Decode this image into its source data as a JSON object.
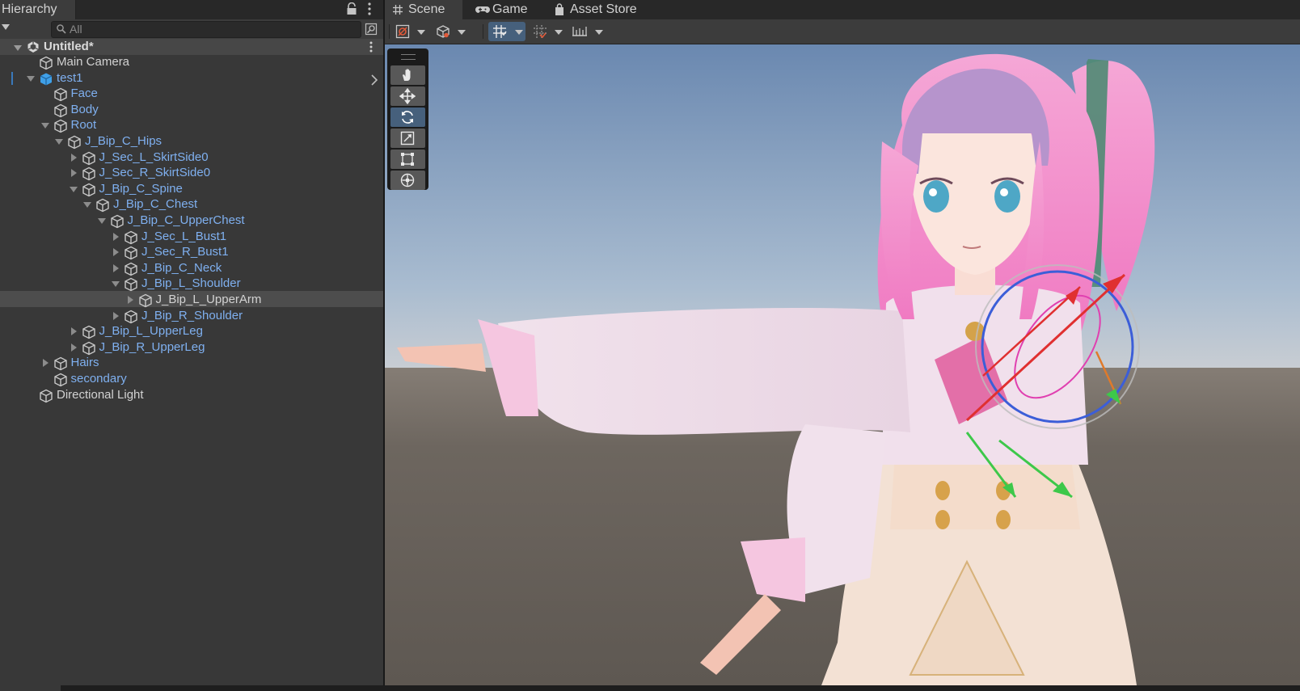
{
  "hierarchy": {
    "title": "Hierarchy",
    "search_placeholder": "All",
    "scene_name": "Untitled*",
    "items": [
      {
        "label": "Main Camera",
        "fold": "none",
        "style": "norm",
        "icon": "gameobject-icon"
      },
      {
        "label": "test1",
        "fold": "open",
        "style": "prefab",
        "icon": "prefab-icon"
      },
      {
        "label": "Face",
        "fold": "none",
        "style": "prefab",
        "icon": "gameobject-icon"
      },
      {
        "label": "Body",
        "fold": "none",
        "style": "prefab",
        "icon": "gameobject-icon"
      },
      {
        "label": "Root",
        "fold": "open",
        "style": "prefab",
        "icon": "gameobject-icon"
      },
      {
        "label": "J_Bip_C_Hips",
        "fold": "open",
        "style": "prefab",
        "icon": "gameobject-icon"
      },
      {
        "label": "J_Sec_L_SkirtSide0",
        "fold": "closed",
        "style": "prefab",
        "icon": "gameobject-icon"
      },
      {
        "label": "J_Sec_R_SkirtSide0",
        "fold": "closed",
        "style": "prefab",
        "icon": "gameobject-icon"
      },
      {
        "label": "J_Bip_C_Spine",
        "fold": "open",
        "style": "prefab",
        "icon": "gameobject-icon"
      },
      {
        "label": "J_Bip_C_Chest",
        "fold": "open",
        "style": "prefab",
        "icon": "gameobject-icon"
      },
      {
        "label": "J_Bip_C_UpperChest",
        "fold": "open",
        "style": "prefab",
        "icon": "gameobject-icon"
      },
      {
        "label": "J_Sec_L_Bust1",
        "fold": "closed",
        "style": "prefab",
        "icon": "gameobject-icon"
      },
      {
        "label": "J_Sec_R_Bust1",
        "fold": "closed",
        "style": "prefab",
        "icon": "gameobject-icon"
      },
      {
        "label": "J_Bip_C_Neck",
        "fold": "closed",
        "style": "prefab",
        "icon": "gameobject-icon"
      },
      {
        "label": "J_Bip_L_Shoulder",
        "fold": "open",
        "style": "prefab",
        "icon": "gameobject-icon"
      },
      {
        "label": "J_Bip_L_UpperArm",
        "fold": "closed",
        "style": "norm",
        "icon": "gameobject-icon",
        "selected": true
      },
      {
        "label": "J_Bip_R_Shoulder",
        "fold": "closed",
        "style": "prefab",
        "icon": "gameobject-icon"
      },
      {
        "label": "J_Bip_L_UpperLeg",
        "fold": "closed",
        "style": "prefab",
        "icon": "gameobject-icon"
      },
      {
        "label": "J_Bip_R_UpperLeg",
        "fold": "closed",
        "style": "prefab",
        "icon": "gameobject-icon"
      },
      {
        "label": "Hairs",
        "fold": "closed",
        "style": "prefab",
        "icon": "gameobject-icon"
      },
      {
        "label": "secondary",
        "fold": "none",
        "style": "prefab",
        "icon": "gameobject-icon"
      },
      {
        "label": "Directional Light",
        "fold": "none",
        "style": "norm",
        "icon": "gameobject-icon"
      }
    ]
  },
  "scene_view": {
    "tabs": [
      {
        "label": "Scene",
        "icon": "grid-icon",
        "active": true
      },
      {
        "label": "Game",
        "icon": "gamepad-icon",
        "active": false
      },
      {
        "label": "Asset Store",
        "icon": "shopping-bag-icon",
        "active": false
      }
    ],
    "toolbar": [
      "draw-mode-icon",
      "shading-cube-icon",
      "grid-snap-icon",
      "increment-snap-icon",
      "ruler-icon"
    ],
    "tools": [
      {
        "name": "hand-tool-icon",
        "active": false
      },
      {
        "name": "move-tool-icon",
        "active": false
      },
      {
        "name": "rotate-tool-icon",
        "active": true
      },
      {
        "name": "scale-tool-icon",
        "active": false
      },
      {
        "name": "rect-tool-icon",
        "active": false
      },
      {
        "name": "transform-tool-icon",
        "active": false
      }
    ]
  },
  "colors": {
    "panel": "#383838",
    "selection": "#4d4d4d",
    "prefab_text": "#7fb0f0",
    "active_tool": "#46607c",
    "sky_top": "#6a88b0",
    "ground": "#645e57"
  }
}
